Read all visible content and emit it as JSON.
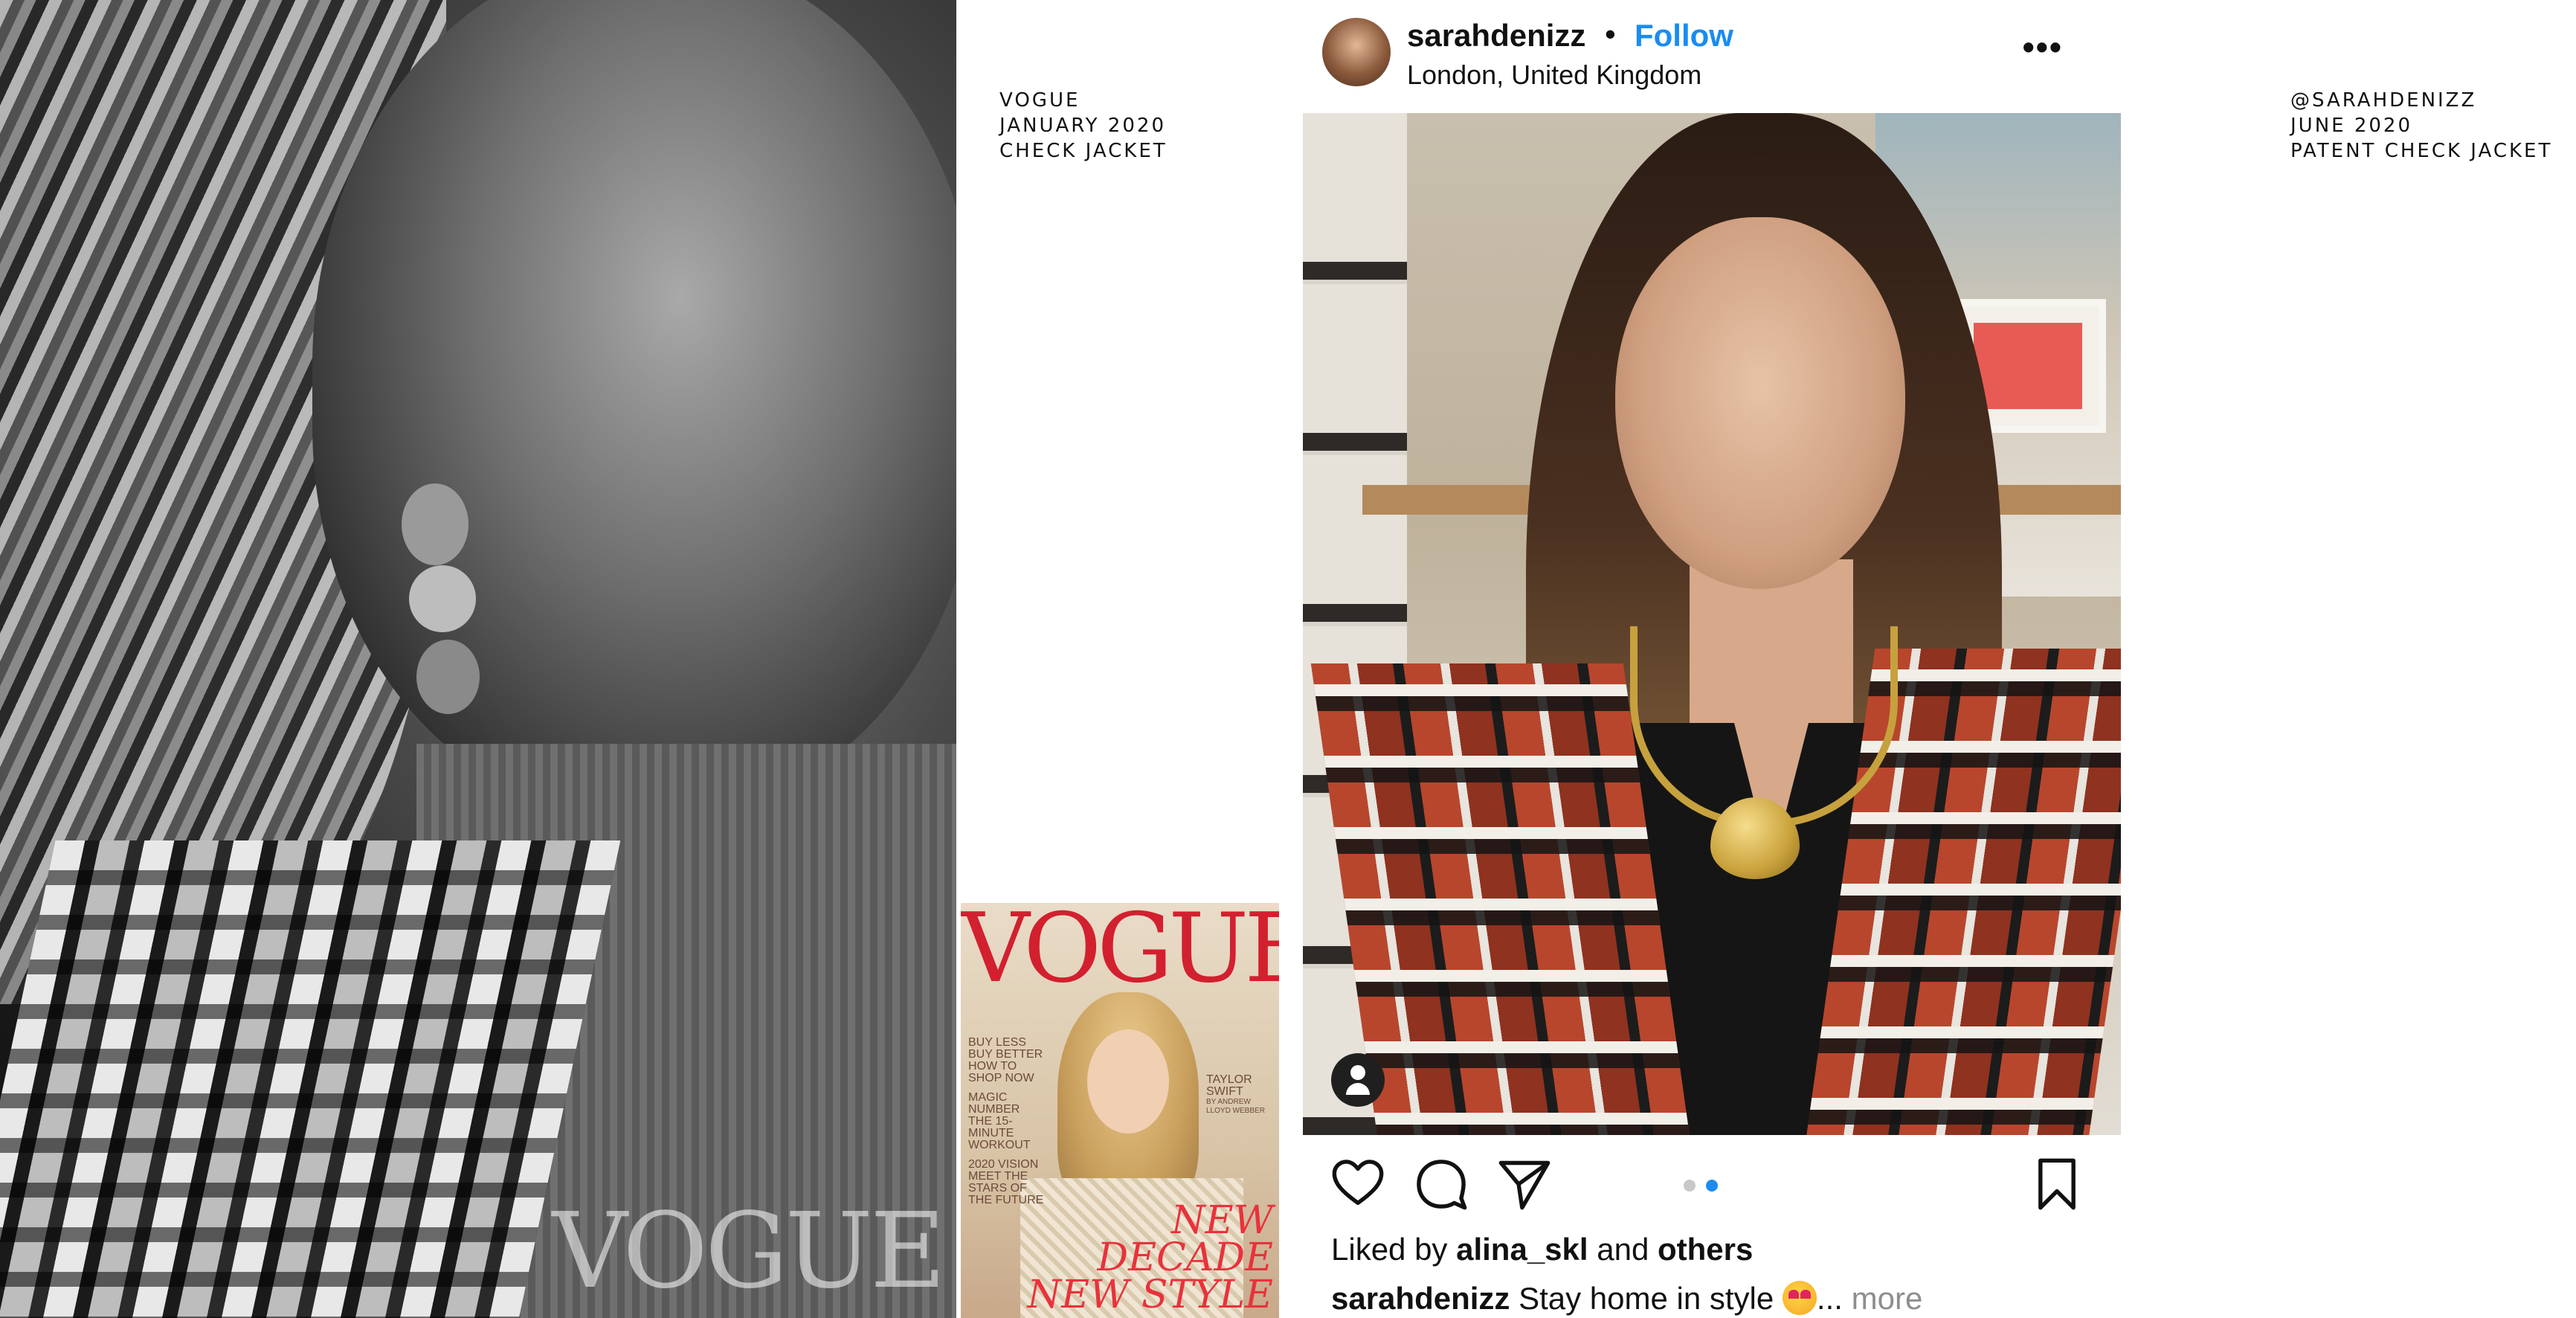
{
  "left_panel": {
    "portrait_alt": "",
    "watermark": "VOGUE"
  },
  "caption_left": {
    "line1": "VOGUE",
    "line2": "JANUARY 2020",
    "line3": "CHECK JACKET"
  },
  "caption_right": {
    "line1": "@SARAHDENIZZ",
    "line2": "JUNE 2020",
    "line3": "PATENT CHECK JACKET"
  },
  "magazine_cover": {
    "masthead": "VOGUE",
    "blurb_left_1": "BUY LESS",
    "blurb_left_2": "BUY BETTER",
    "blurb_left_3": "HOW TO",
    "blurb_left_4": "SHOP NOW",
    "blurb_left_5": "MAGIC",
    "blurb_left_6": "NUMBER",
    "blurb_left_7": "THE 15-MINUTE",
    "blurb_left_8": "WORKOUT",
    "blurb_left_9": "2020 VISION",
    "blurb_left_10": "MEET THE",
    "blurb_left_11": "STARS OF",
    "blurb_left_12": "THE FUTURE",
    "blurb_right_1": "TAYLOR",
    "blurb_right_2": "SWIFT",
    "blurb_right_3": "BY ANDREW LLOYD WEBBER",
    "headline_1": "NEW DECADE",
    "headline_2": "NEW STYLE"
  },
  "instagram_post": {
    "username": "sarahdenizz",
    "separator": "•",
    "follow_label": "Follow",
    "location": "London, United Kingdom",
    "more_options": "•••",
    "carousel": {
      "count": 2,
      "active_index": 1
    },
    "likes": {
      "prefix": "Liked by ",
      "user": "alina_skl",
      "middle": " and ",
      "suffix": "others"
    },
    "caption": {
      "username": "sarahdenizz",
      "text": " Stay home in style ",
      "ellipsis": "... ",
      "more_label": "more"
    },
    "icons": {
      "like": "heart-icon",
      "comment": "comment-icon",
      "share": "send-icon",
      "save": "bookmark-icon",
      "user_tag": "user-icon",
      "emoji": "heart-eyes-emoji"
    },
    "colors": {
      "follow": "#1a8cf0",
      "dot_active": "#1a8cf0",
      "dot_inactive": "#c8c8c8",
      "more": "#8e8e8e"
    }
  }
}
